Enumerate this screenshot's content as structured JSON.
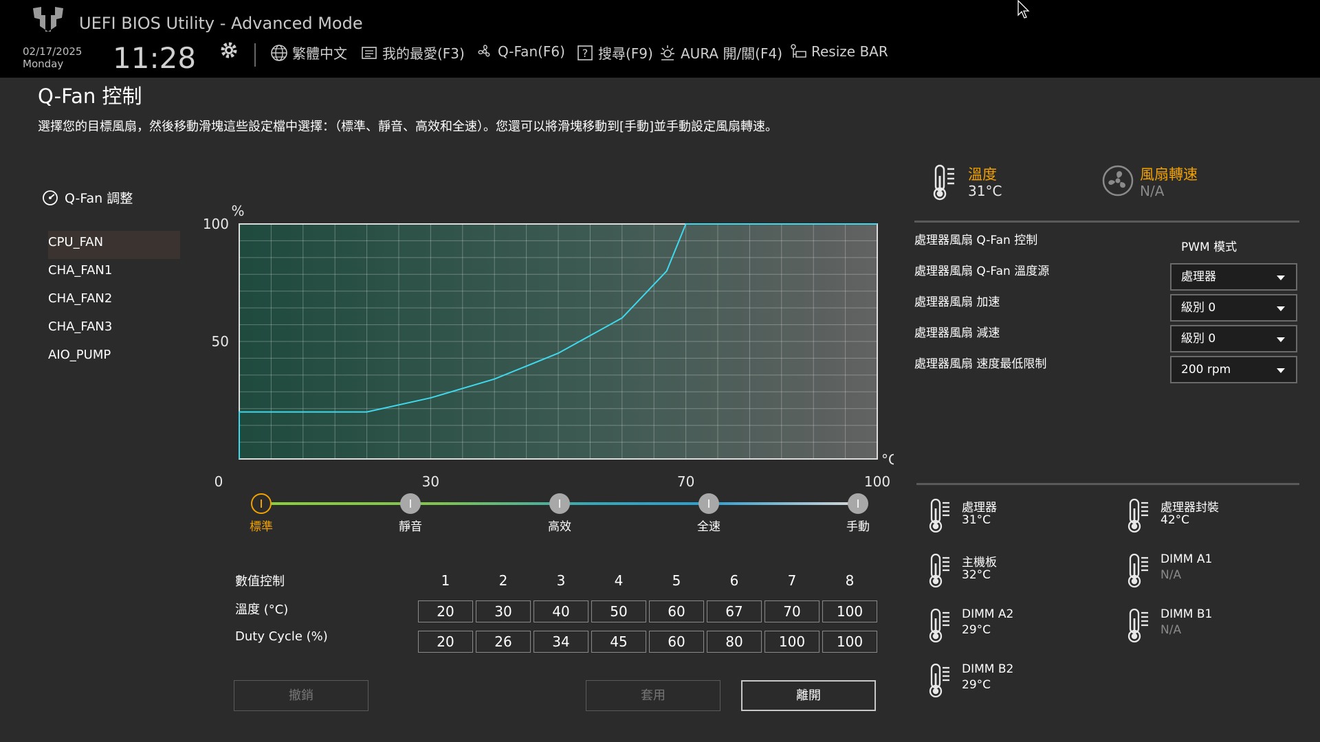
{
  "header": {
    "app_title": "UEFI BIOS Utility - Advanced Mode",
    "date": "02/17/2025",
    "weekday": "Monday",
    "time": "11:28",
    "menu": [
      {
        "label": "繁體中文",
        "icon": "globe-icon"
      },
      {
        "label": "我的最愛(F3)",
        "icon": "favorites-icon"
      },
      {
        "label": "Q-Fan(F6)",
        "icon": "fan-icon"
      },
      {
        "label": "搜尋(F9)",
        "icon": "help-search-icon"
      },
      {
        "label": "AURA 開/關(F4)",
        "icon": "aura-icon"
      },
      {
        "label": "Resize BAR",
        "icon": "resize-bar-icon"
      }
    ]
  },
  "page": {
    "title": "Q-Fan 控制",
    "description": "選擇您的目標風扇，然後移動滑塊這些設定檔中選擇：（標準、靜音、高效和全速）。您還可以將滑塊移動到[手動]並手動設定風扇轉速。"
  },
  "fan_panel": {
    "heading": "Q-Fan 調整",
    "fans": [
      "CPU_FAN",
      "CHA_FAN1",
      "CHA_FAN2",
      "CHA_FAN3",
      "AIO_PUMP"
    ],
    "selected_index": 0
  },
  "chart_data": {
    "type": "line",
    "x": [
      0,
      20,
      30,
      40,
      50,
      60,
      67,
      70,
      100
    ],
    "y": [
      20,
      20,
      26,
      34,
      45,
      60,
      80,
      100,
      100
    ],
    "xlim": [
      0,
      100
    ],
    "ylim": [
      0,
      100
    ],
    "ylabel": "%",
    "xlabel": "°C",
    "x_ticks": [
      "0",
      "30",
      "70",
      "100"
    ],
    "y_ticks": [
      "100",
      "50"
    ],
    "grid": true,
    "line_color": "#3fd8ec"
  },
  "profiles": {
    "options": [
      "標準",
      "靜音",
      "高效",
      "全速",
      "手動"
    ],
    "selected_index": 0
  },
  "point_table": {
    "header_label": "數值控制",
    "columns": [
      "1",
      "2",
      "3",
      "4",
      "5",
      "6",
      "7",
      "8"
    ],
    "temp_label": "溫度 (°C)",
    "temps": [
      "20",
      "30",
      "40",
      "50",
      "60",
      "67",
      "70",
      "100"
    ],
    "duty_label": "Duty Cycle (%)",
    "duties": [
      "20",
      "26",
      "34",
      "45",
      "60",
      "80",
      "100",
      "100"
    ]
  },
  "buttons": {
    "undo": "撤銷",
    "apply": "套用",
    "exit": "離開"
  },
  "status": {
    "temp_title": "溫度",
    "temp_value": "31°C",
    "fan_title": "風扇轉速",
    "fan_value": "N/A"
  },
  "settings": {
    "control_label": "處理器風扇 Q-Fan 控制",
    "control_value": "PWM 模式",
    "source_label": "處理器風扇 Q-Fan 溫度源",
    "source_value": "處理器",
    "step_up_label": "處理器風扇 加速",
    "step_up_value": "級別 0",
    "step_down_label": "處理器風扇 減速",
    "step_down_value": "級別 0",
    "min_limit_label": "處理器風扇 速度最低限制",
    "min_limit_value": "200 rpm"
  },
  "sensors": [
    {
      "name": "處理器",
      "value": "31°C"
    },
    {
      "name": "處理器封裝",
      "value": "42°C"
    },
    {
      "name": "主機板",
      "value": "32°C"
    },
    {
      "name": "DIMM A1",
      "value": "N/A"
    },
    {
      "name": "DIMM A2",
      "value": "29°C"
    },
    {
      "name": "DIMM B1",
      "value": "N/A"
    },
    {
      "name": "DIMM B2",
      "value": "29°C"
    }
  ],
  "colors": {
    "accent": "#f2a200",
    "curve": "#3fd8ec",
    "background": "#2b2b2b",
    "topbar": "#000000"
  }
}
